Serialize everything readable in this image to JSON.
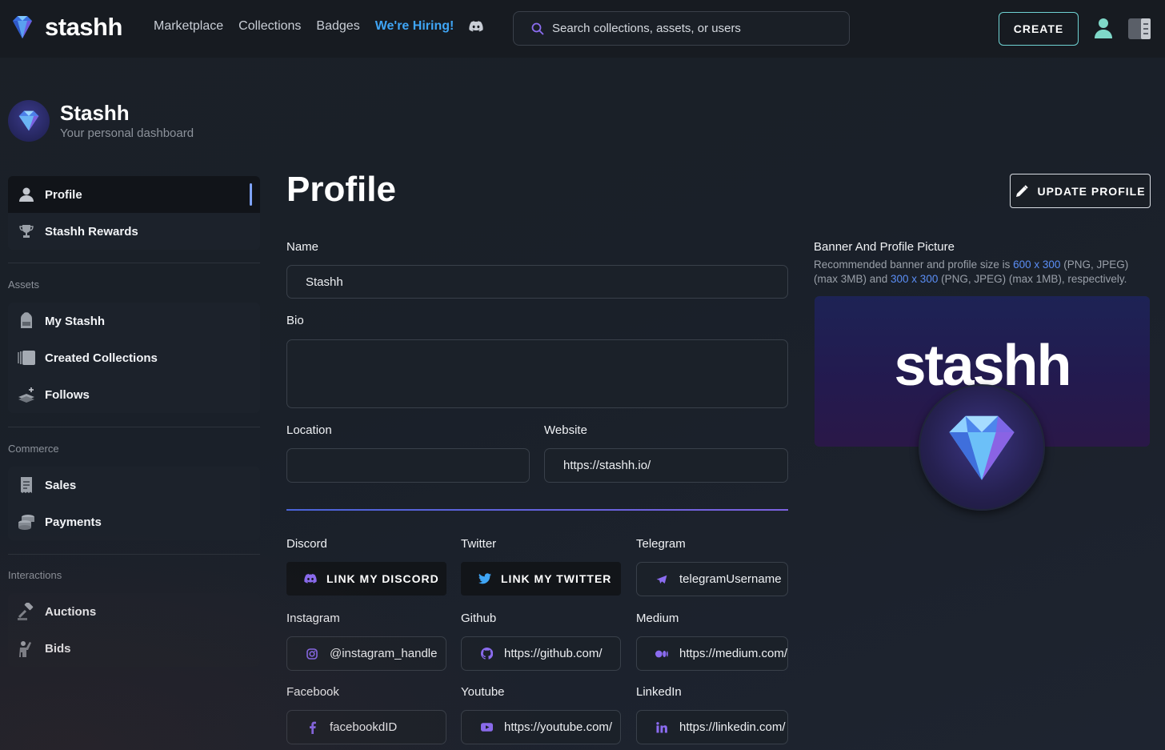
{
  "nav": {
    "brand": "stashh",
    "links": [
      "Marketplace",
      "Collections",
      "Badges"
    ],
    "hiring": "We're Hiring!",
    "search_placeholder": "Search collections, assets, or users",
    "create": "CREATE"
  },
  "dashboard": {
    "title": "Stashh",
    "subtitle": "Your personal dashboard"
  },
  "sidebar": {
    "top": [
      {
        "label": "Profile",
        "icon": "person-icon",
        "active": true
      },
      {
        "label": "Stashh Rewards",
        "icon": "trophy-icon"
      }
    ],
    "assets_label": "Assets",
    "assets": [
      {
        "label": "My Stashh",
        "icon": "backpack-icon"
      },
      {
        "label": "Created Collections",
        "icon": "collection-icon"
      },
      {
        "label": "Follows",
        "icon": "stack-plus-icon"
      }
    ],
    "commerce_label": "Commerce",
    "commerce": [
      {
        "label": "Sales",
        "icon": "receipt-icon"
      },
      {
        "label": "Payments",
        "icon": "coins-icon"
      }
    ],
    "interactions_label": "Interactions",
    "interactions": [
      {
        "label": "Auctions",
        "icon": "gavel-icon"
      },
      {
        "label": "Bids",
        "icon": "hand-raise-icon"
      }
    ]
  },
  "main": {
    "title": "Profile",
    "update_button": "UPDATE PROFILE",
    "name_label": "Name",
    "name_value": "Stashh",
    "bio_label": "Bio",
    "bio_value": "",
    "location_label": "Location",
    "location_value": "",
    "website_label": "Website",
    "website_value": "https://stashh.io/",
    "discord_label": "Discord",
    "discord_button": "LINK MY DISCORD",
    "twitter_label": "Twitter",
    "twitter_button": "LINK MY TWITTER",
    "telegram_label": "Telegram",
    "telegram_placeholder": "telegramUsername",
    "instagram_label": "Instagram",
    "instagram_placeholder": "@instagram_handle",
    "github_label": "Github",
    "github_placeholder": "https://github.com/",
    "medium_label": "Medium",
    "medium_placeholder": "https://medium.com/",
    "facebook_label": "Facebook",
    "facebook_placeholder": "facebookdID",
    "youtube_label": "Youtube",
    "youtube_placeholder": "https://youtube.com/",
    "linkedin_label": "LinkedIn",
    "linkedin_placeholder": "https://linkedin.com/"
  },
  "banner": {
    "title": "Banner And Profile Picture",
    "desc_1": "Recommended banner and profile size is ",
    "banner_size": "600 x 300",
    "desc_2": " (PNG, JPEG) (max 3MB) and ",
    "profile_size": "300 x 300",
    "desc_3": " (PNG, JPEG) (max 1MB), respectively.",
    "banner_text": "stashh"
  },
  "colors": {
    "accent_teal": "#6fd3d3",
    "link_blue": "#3fa5f5",
    "highlight_blue": "#5b8ef6",
    "icon_purple": "#8b6cf0"
  }
}
